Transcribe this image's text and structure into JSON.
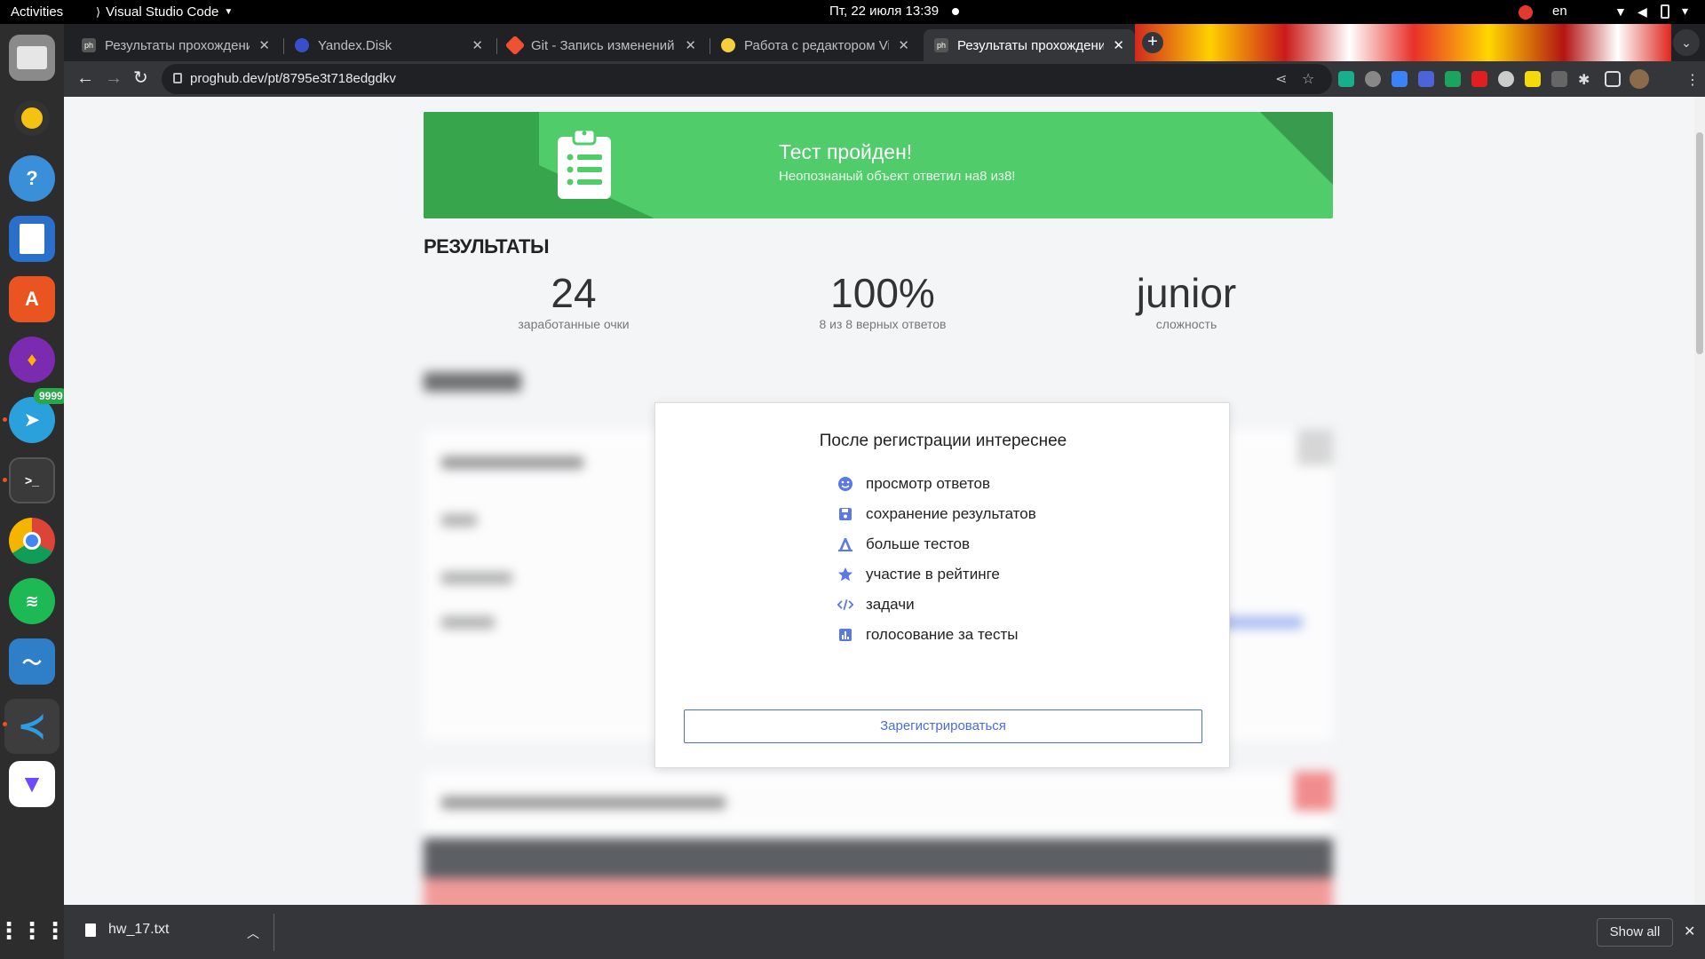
{
  "topbar": {
    "activities": "Activities",
    "app_name": "Visual Studio Code",
    "clock": "Пт, 22 июля  13:39",
    "language": "en"
  },
  "dock": {
    "telegram_badge": "9999"
  },
  "browser": {
    "tabs": [
      {
        "title": "Результаты прохождения",
        "favicon": "ph",
        "active": false
      },
      {
        "title": "Yandex.Disk",
        "favicon": "disk",
        "active": false
      },
      {
        "title": "Git - Запись изменений в",
        "favicon": "git",
        "active": false
      },
      {
        "title": "Работа с редактором Vim",
        "favicon": "smile",
        "active": false
      },
      {
        "title": "Результаты прохождения",
        "favicon": "ph",
        "active": true
      }
    ],
    "url": "proghub.dev/pt/8795e3t718edgdkv"
  },
  "page": {
    "banner": {
      "title": "Тест пройден!",
      "subtitle": "Неопознаный объект ответил на8 из8!"
    },
    "results_heading": "РЕЗУЛЬТАТЫ",
    "stats": [
      {
        "value": "24",
        "caption": "заработанные очки"
      },
      {
        "value": "100%",
        "caption": "8 из 8 верных ответов"
      },
      {
        "value": "junior",
        "caption": "сложность"
      }
    ],
    "modal": {
      "title": "После регистрации интереснее",
      "features": [
        {
          "label": "просмотр ответов",
          "icon": "smile-icon"
        },
        {
          "label": "сохранение результатов",
          "icon": "save-icon"
        },
        {
          "label": "больше тестов",
          "icon": "tests-icon"
        },
        {
          "label": "участие в рейтинге",
          "icon": "star-icon"
        },
        {
          "label": "задачи",
          "icon": "code-icon"
        },
        {
          "label": "голосование за тесты",
          "icon": "chart-icon"
        }
      ],
      "register_button": "Зарегистрироваться"
    }
  },
  "downloads": {
    "file_name": "hw_17.txt",
    "show_all": "Show all"
  },
  "colors": {
    "success_green": "#50cd6a",
    "success_dark": "#36a54c",
    "accent_blue": "#4a6ed8"
  }
}
